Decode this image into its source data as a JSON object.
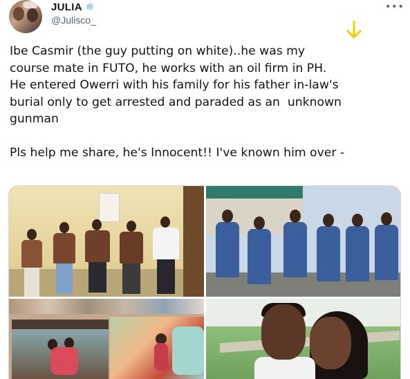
{
  "author": {
    "display_name": "JULIA",
    "badge_glyph": "❄",
    "handle": "@Julisco_",
    "more_glyph": "•••"
  },
  "tweet": {
    "text": "Ibe Casmir (the guy putting on white)..he was my\ncourse mate in FUTO, he works with an oil firm in PH.\nHe entered Owerri with his family for his father in-law's\nburial only to get arrested and paraded as an  unknown\ngunman\n\nPls help me share, he's Innocent!! I've known him over -"
  },
  "colors": {
    "text": "#0f1419",
    "secondary": "#536471",
    "border": "#cfd9de",
    "arrow": "#f5d000"
  }
}
